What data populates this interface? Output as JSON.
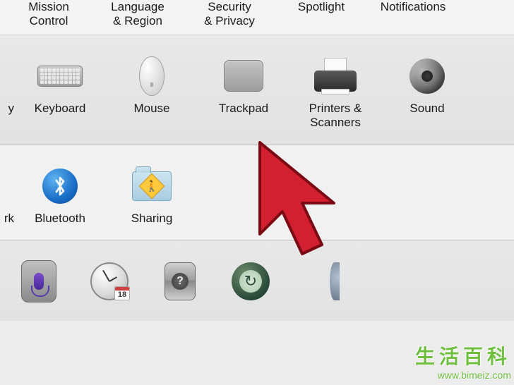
{
  "row1": {
    "items": [
      {
        "label": "Mission\nControl"
      },
      {
        "label": "Language\n& Region"
      },
      {
        "label": "Security\n& Privacy"
      },
      {
        "label": "Spotlight"
      },
      {
        "label": "Notifications"
      }
    ]
  },
  "row2": {
    "partial_label": "y",
    "items": [
      {
        "label": "Keyboard"
      },
      {
        "label": "Mouse"
      },
      {
        "label": "Trackpad"
      },
      {
        "label": "Printers &\nScanners"
      },
      {
        "label": "Sound"
      }
    ]
  },
  "row3": {
    "partial_label": "rk",
    "items": [
      {
        "label": "Bluetooth"
      },
      {
        "label": "Sharing"
      }
    ]
  },
  "row4": {
    "calendar_day": "18"
  },
  "watermark": {
    "text": "生活百科",
    "url": "www.bimeiz.com"
  }
}
